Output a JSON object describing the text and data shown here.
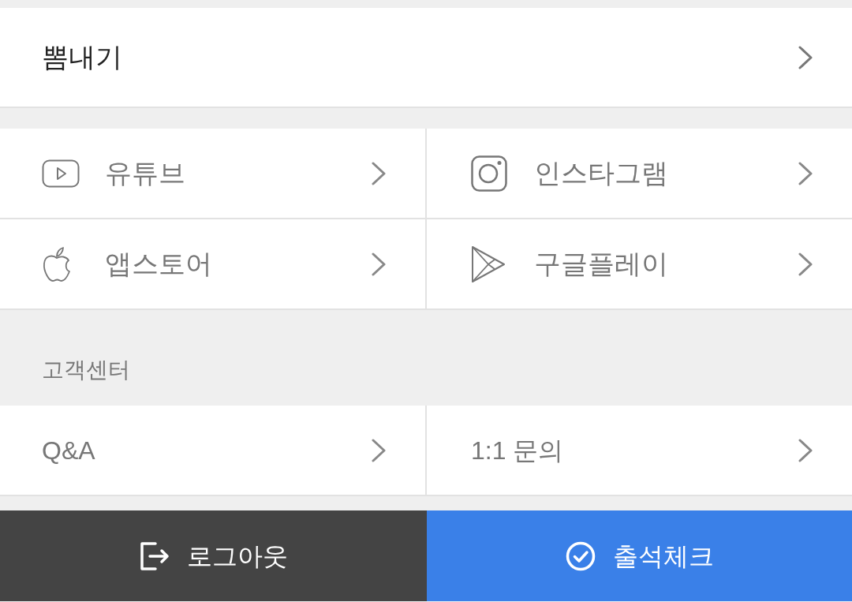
{
  "menu_item": {
    "label": "뽐내기"
  },
  "social_links": [
    {
      "label": "유튜브",
      "kind": "video"
    },
    {
      "label": "인스타그램",
      "kind": "camera"
    },
    {
      "label": "앱스토어",
      "kind": "apple"
    },
    {
      "label": "구글플레이",
      "kind": "play"
    }
  ],
  "customer_center": {
    "title": "고객센터",
    "links": [
      {
        "label": "Q&A"
      },
      {
        "label": "1:1 문의"
      }
    ]
  },
  "footer_buttons": [
    {
      "label": "로그아웃",
      "kind": "logout"
    },
    {
      "label": "출석체크",
      "kind": "attendance"
    }
  ]
}
